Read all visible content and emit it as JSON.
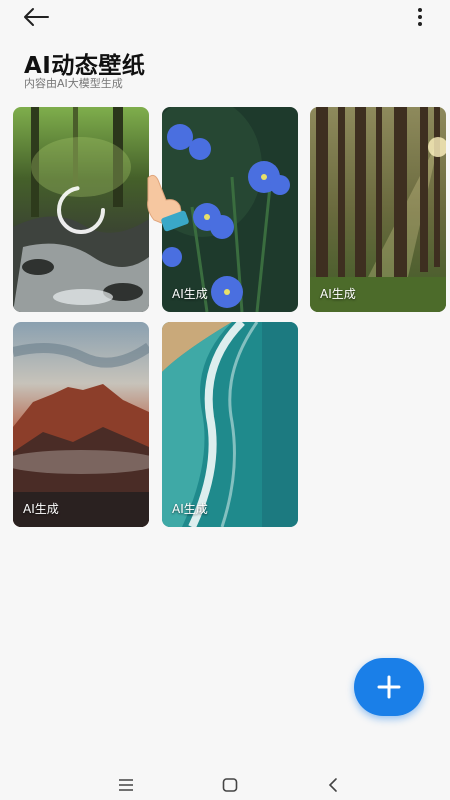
{
  "header": {
    "back_icon": "arrow-left-icon",
    "more_icon": "more-vertical-icon",
    "title": "AI动态壁纸",
    "subtitle": "内容由AI大模型生成"
  },
  "wallpapers": [
    {
      "scene": "forest stream",
      "badge": "",
      "loading": true
    },
    {
      "scene": "blue flowers",
      "badge": "AI生成"
    },
    {
      "scene": "sunlit forest",
      "badge": "AI生成"
    },
    {
      "scene": "mountain at sunset",
      "badge": "AI生成"
    },
    {
      "scene": "ocean waves",
      "badge": "AI生成"
    }
  ],
  "fab": {
    "icon": "plus-icon",
    "color": "#1a7fe8"
  },
  "navbar": {
    "items": [
      "menu-icon",
      "home-square-icon",
      "back-chevron-icon"
    ]
  }
}
